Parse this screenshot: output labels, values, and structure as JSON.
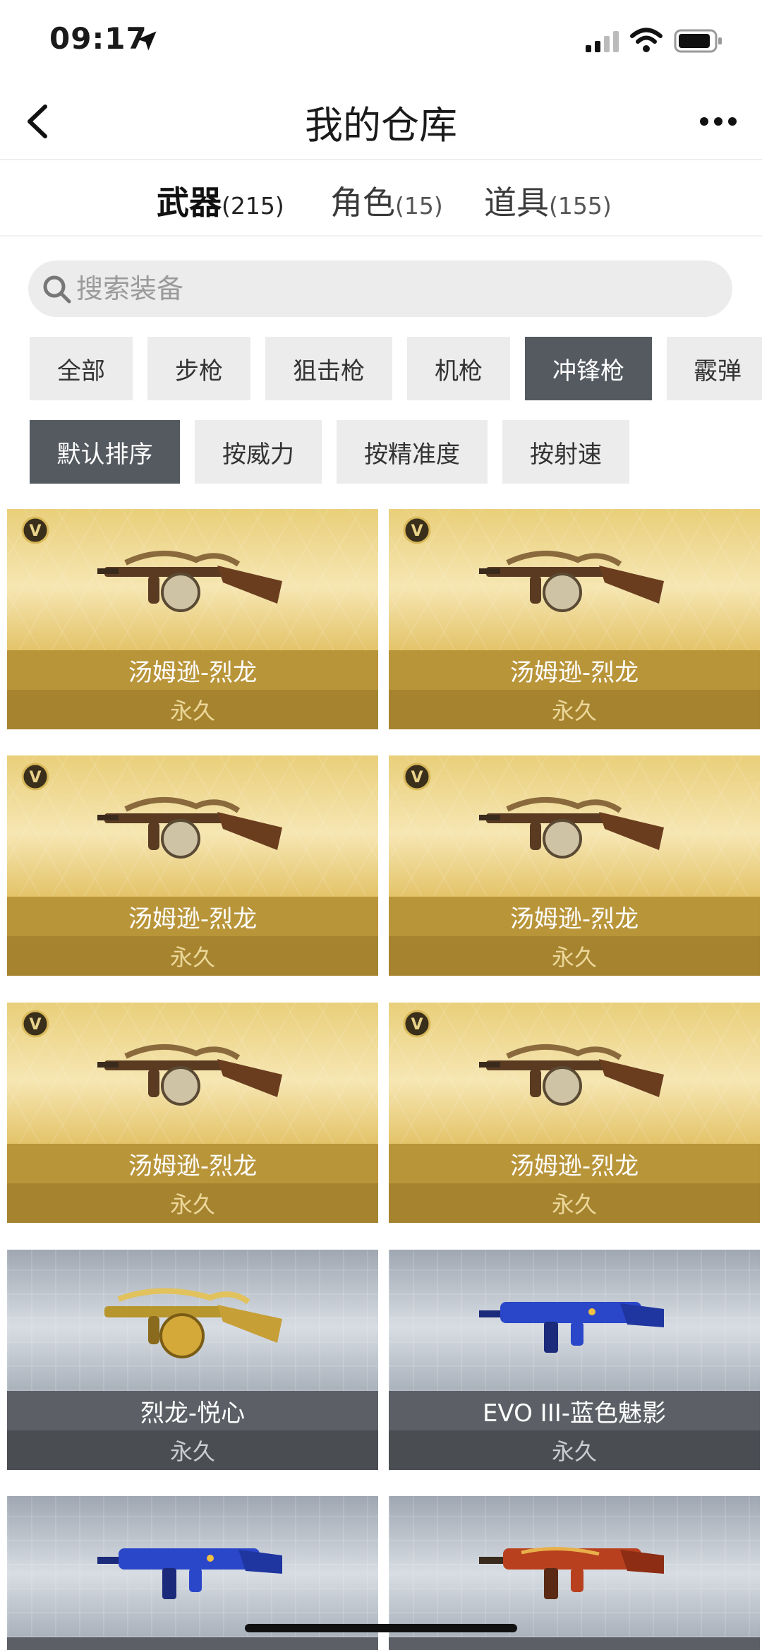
{
  "status_bar": {
    "time": "09:17"
  },
  "nav": {
    "title": "我的仓库"
  },
  "tabs": [
    {
      "label": "武器",
      "count": "(215)"
    },
    {
      "label": "角色",
      "count": "(15)"
    },
    {
      "label": "道具",
      "count": "(155)"
    }
  ],
  "search": {
    "placeholder": "搜索装备"
  },
  "categories": [
    "全部",
    "步枪",
    "狙击枪",
    "机枪",
    "冲锋枪",
    "霰弹"
  ],
  "active_category": "冲锋枪",
  "sort_options": [
    "默认排序",
    "按威力",
    "按精准度",
    "按射速"
  ],
  "active_sort": "默认排序",
  "items": [
    {
      "name": "汤姆逊-烈龙",
      "duration": "永久",
      "rarity": "gold"
    },
    {
      "name": "汤姆逊-烈龙",
      "duration": "永久",
      "rarity": "gold"
    },
    {
      "name": "汤姆逊-烈龙",
      "duration": "永久",
      "rarity": "gold"
    },
    {
      "name": "汤姆逊-烈龙",
      "duration": "永久",
      "rarity": "gold"
    },
    {
      "name": "汤姆逊-烈龙",
      "duration": "永久",
      "rarity": "gold"
    },
    {
      "name": "汤姆逊-烈龙",
      "duration": "永久",
      "rarity": "gold"
    },
    {
      "name": "烈龙-悦心",
      "duration": "永久",
      "rarity": "silver"
    },
    {
      "name": "EVO III-蓝色魅影",
      "duration": "永久",
      "rarity": "silver"
    },
    {
      "name": "",
      "duration": "",
      "rarity": "silver"
    },
    {
      "name": "",
      "duration": "",
      "rarity": "silver"
    }
  ],
  "colors": {
    "gold_band": "#b9953a",
    "silver_band": "#5c6066",
    "active_chip": "#555a61"
  }
}
